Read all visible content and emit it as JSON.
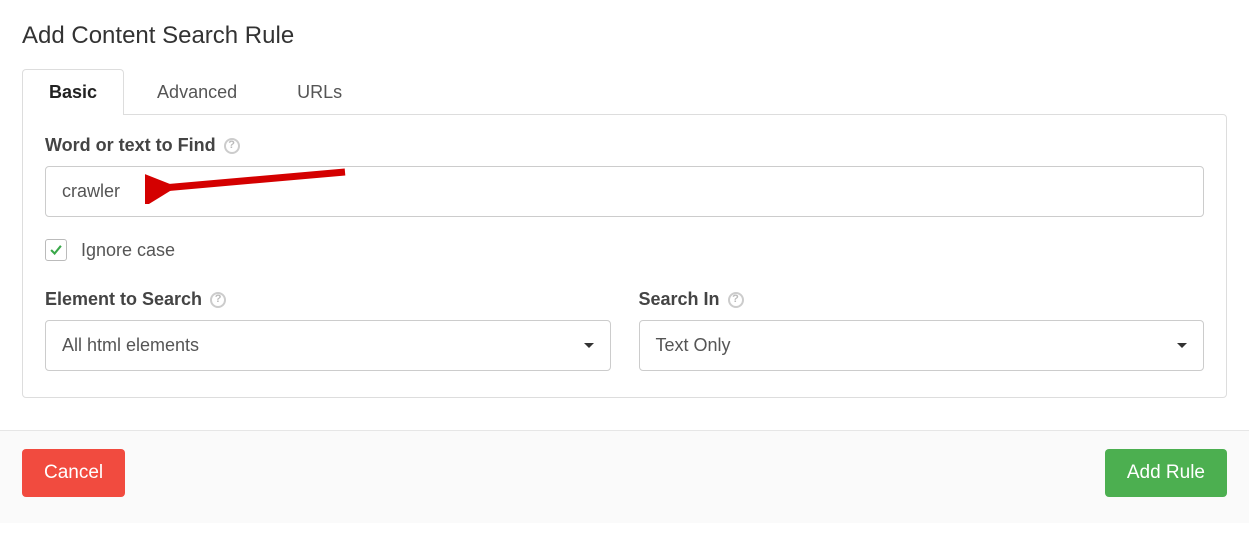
{
  "title": "Add Content Search Rule",
  "tabs": [
    "Basic",
    "Advanced",
    "URLs"
  ],
  "active_tab_index": 0,
  "fields": {
    "word_label": "Word or text to Find",
    "word_value": "crawler",
    "ignore_case_label": "Ignore case",
    "ignore_case_checked": true,
    "element_label": "Element to Search",
    "element_value": "All html elements",
    "searchin_label": "Search In",
    "searchin_value": "Text Only"
  },
  "buttons": {
    "cancel": "Cancel",
    "add": "Add Rule"
  },
  "annotation": {
    "arrow_points_to": "word-input"
  }
}
